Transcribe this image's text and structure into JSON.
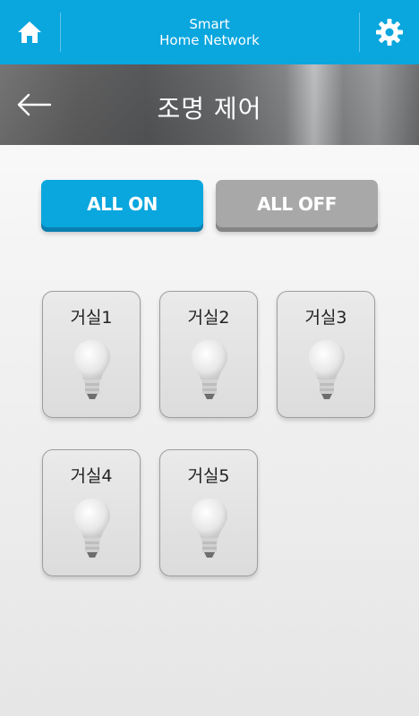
{
  "header": {
    "title_line1": "Smart",
    "title_line2": "Home Network",
    "home_icon": "home-icon",
    "settings_icon": "gear-icon",
    "accent_color": "#0aa6de"
  },
  "banner": {
    "title": "조명 제어",
    "back_icon": "arrow-left-icon"
  },
  "controls": {
    "all_on_label": "ALL ON",
    "all_off_label": "ALL OFF"
  },
  "lights": [
    {
      "label": "거실1",
      "icon": "light-bulb-icon"
    },
    {
      "label": "거실2",
      "icon": "light-bulb-icon"
    },
    {
      "label": "거실3",
      "icon": "light-bulb-icon"
    },
    {
      "label": "거실4",
      "icon": "light-bulb-icon"
    },
    {
      "label": "거실5",
      "icon": "light-bulb-icon"
    }
  ]
}
